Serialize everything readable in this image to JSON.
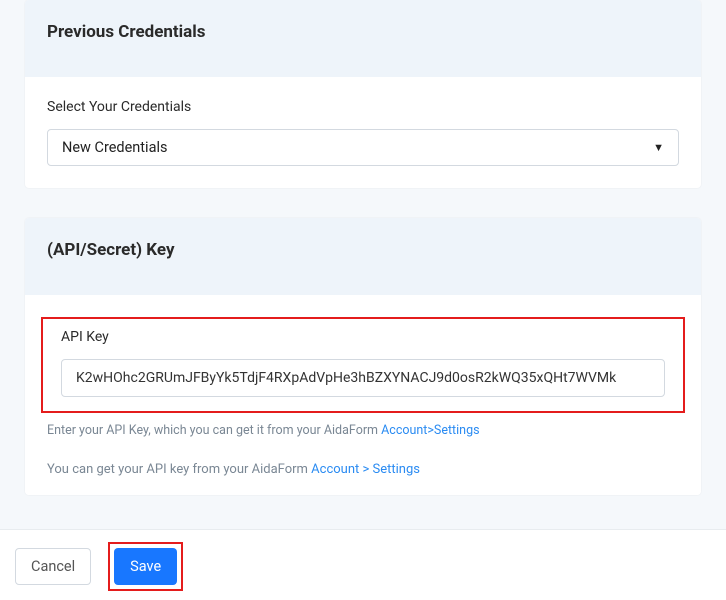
{
  "sections": {
    "prev_credentials": {
      "title": "Previous Credentials",
      "field_label": "Select Your Credentials",
      "selected_value": "New Credentials"
    },
    "api_secret": {
      "title": "(API/Secret) Key",
      "api_key_label": "API Key",
      "api_key_value": "K2wHOhc2GRUmJFByYk5TdjF4RXpAdVpHe3hBZXYNACJ9d0osR2kWQ35xQHt7WVMk",
      "help1_prefix": "Enter your API Key, which you can get it from your AidaForm ",
      "help1_link": "Account>Settings",
      "help2_prefix": "You can get your API key from your AidaForm ",
      "help2_link": "Account > Settings"
    }
  },
  "footer": {
    "cancel": "Cancel",
    "save": "Save"
  }
}
